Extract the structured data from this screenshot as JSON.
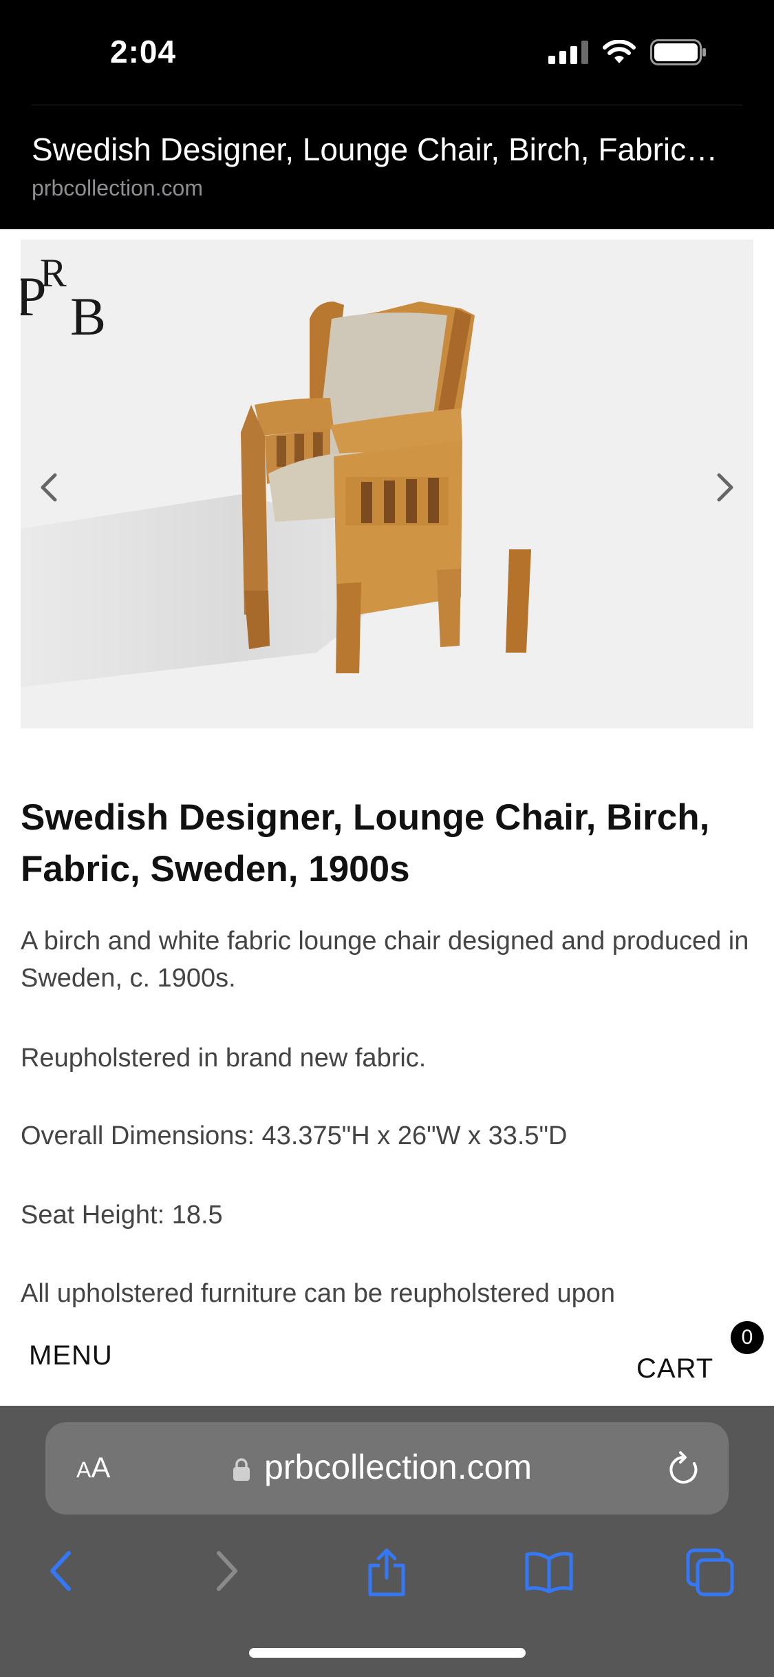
{
  "status_bar": {
    "time": "2:04",
    "icons": [
      "cellular-signal-icon",
      "wifi-icon",
      "battery-icon"
    ]
  },
  "page_header": {
    "title": "Swedish Designer, Lounge Chair, Birch, Fabric…",
    "domain": "prbcollection.com"
  },
  "gallery": {
    "logo_text": "PRB",
    "icons": {
      "prev": "chevron-left-icon",
      "next": "chevron-right-icon"
    }
  },
  "product": {
    "title": "Swedish Designer, Lounge Chair, Birch, Fabric, Sweden, 1900s",
    "description": [
      "A birch and white fabric lounge chair designed and produced in Sweden, c. 1900s.",
      "Reupholstered in brand new fabric.",
      "Overall Dimensions: 43.375\"H x 26\"W x 33.5\"D",
      "Seat Height: 18.5",
      "All upholstered furniture can be reupholstered upon"
    ]
  },
  "site_nav": {
    "menu_label": "MENU",
    "cart_label": "CART",
    "cart_count": "0"
  },
  "browser": {
    "text_size_small": "A",
    "text_size_large": "A",
    "url": "prbcollection.com",
    "toolbar_icons": [
      "back-icon",
      "forward-icon",
      "share-icon",
      "bookmarks-icon",
      "tabs-icon"
    ]
  },
  "colors": {
    "header_bg": "#000000",
    "safari_bg": "#575757",
    "url_bar_bg": "#747474",
    "ios_blue": "#3478f6",
    "disabled_gray": "#8a8a8a"
  }
}
